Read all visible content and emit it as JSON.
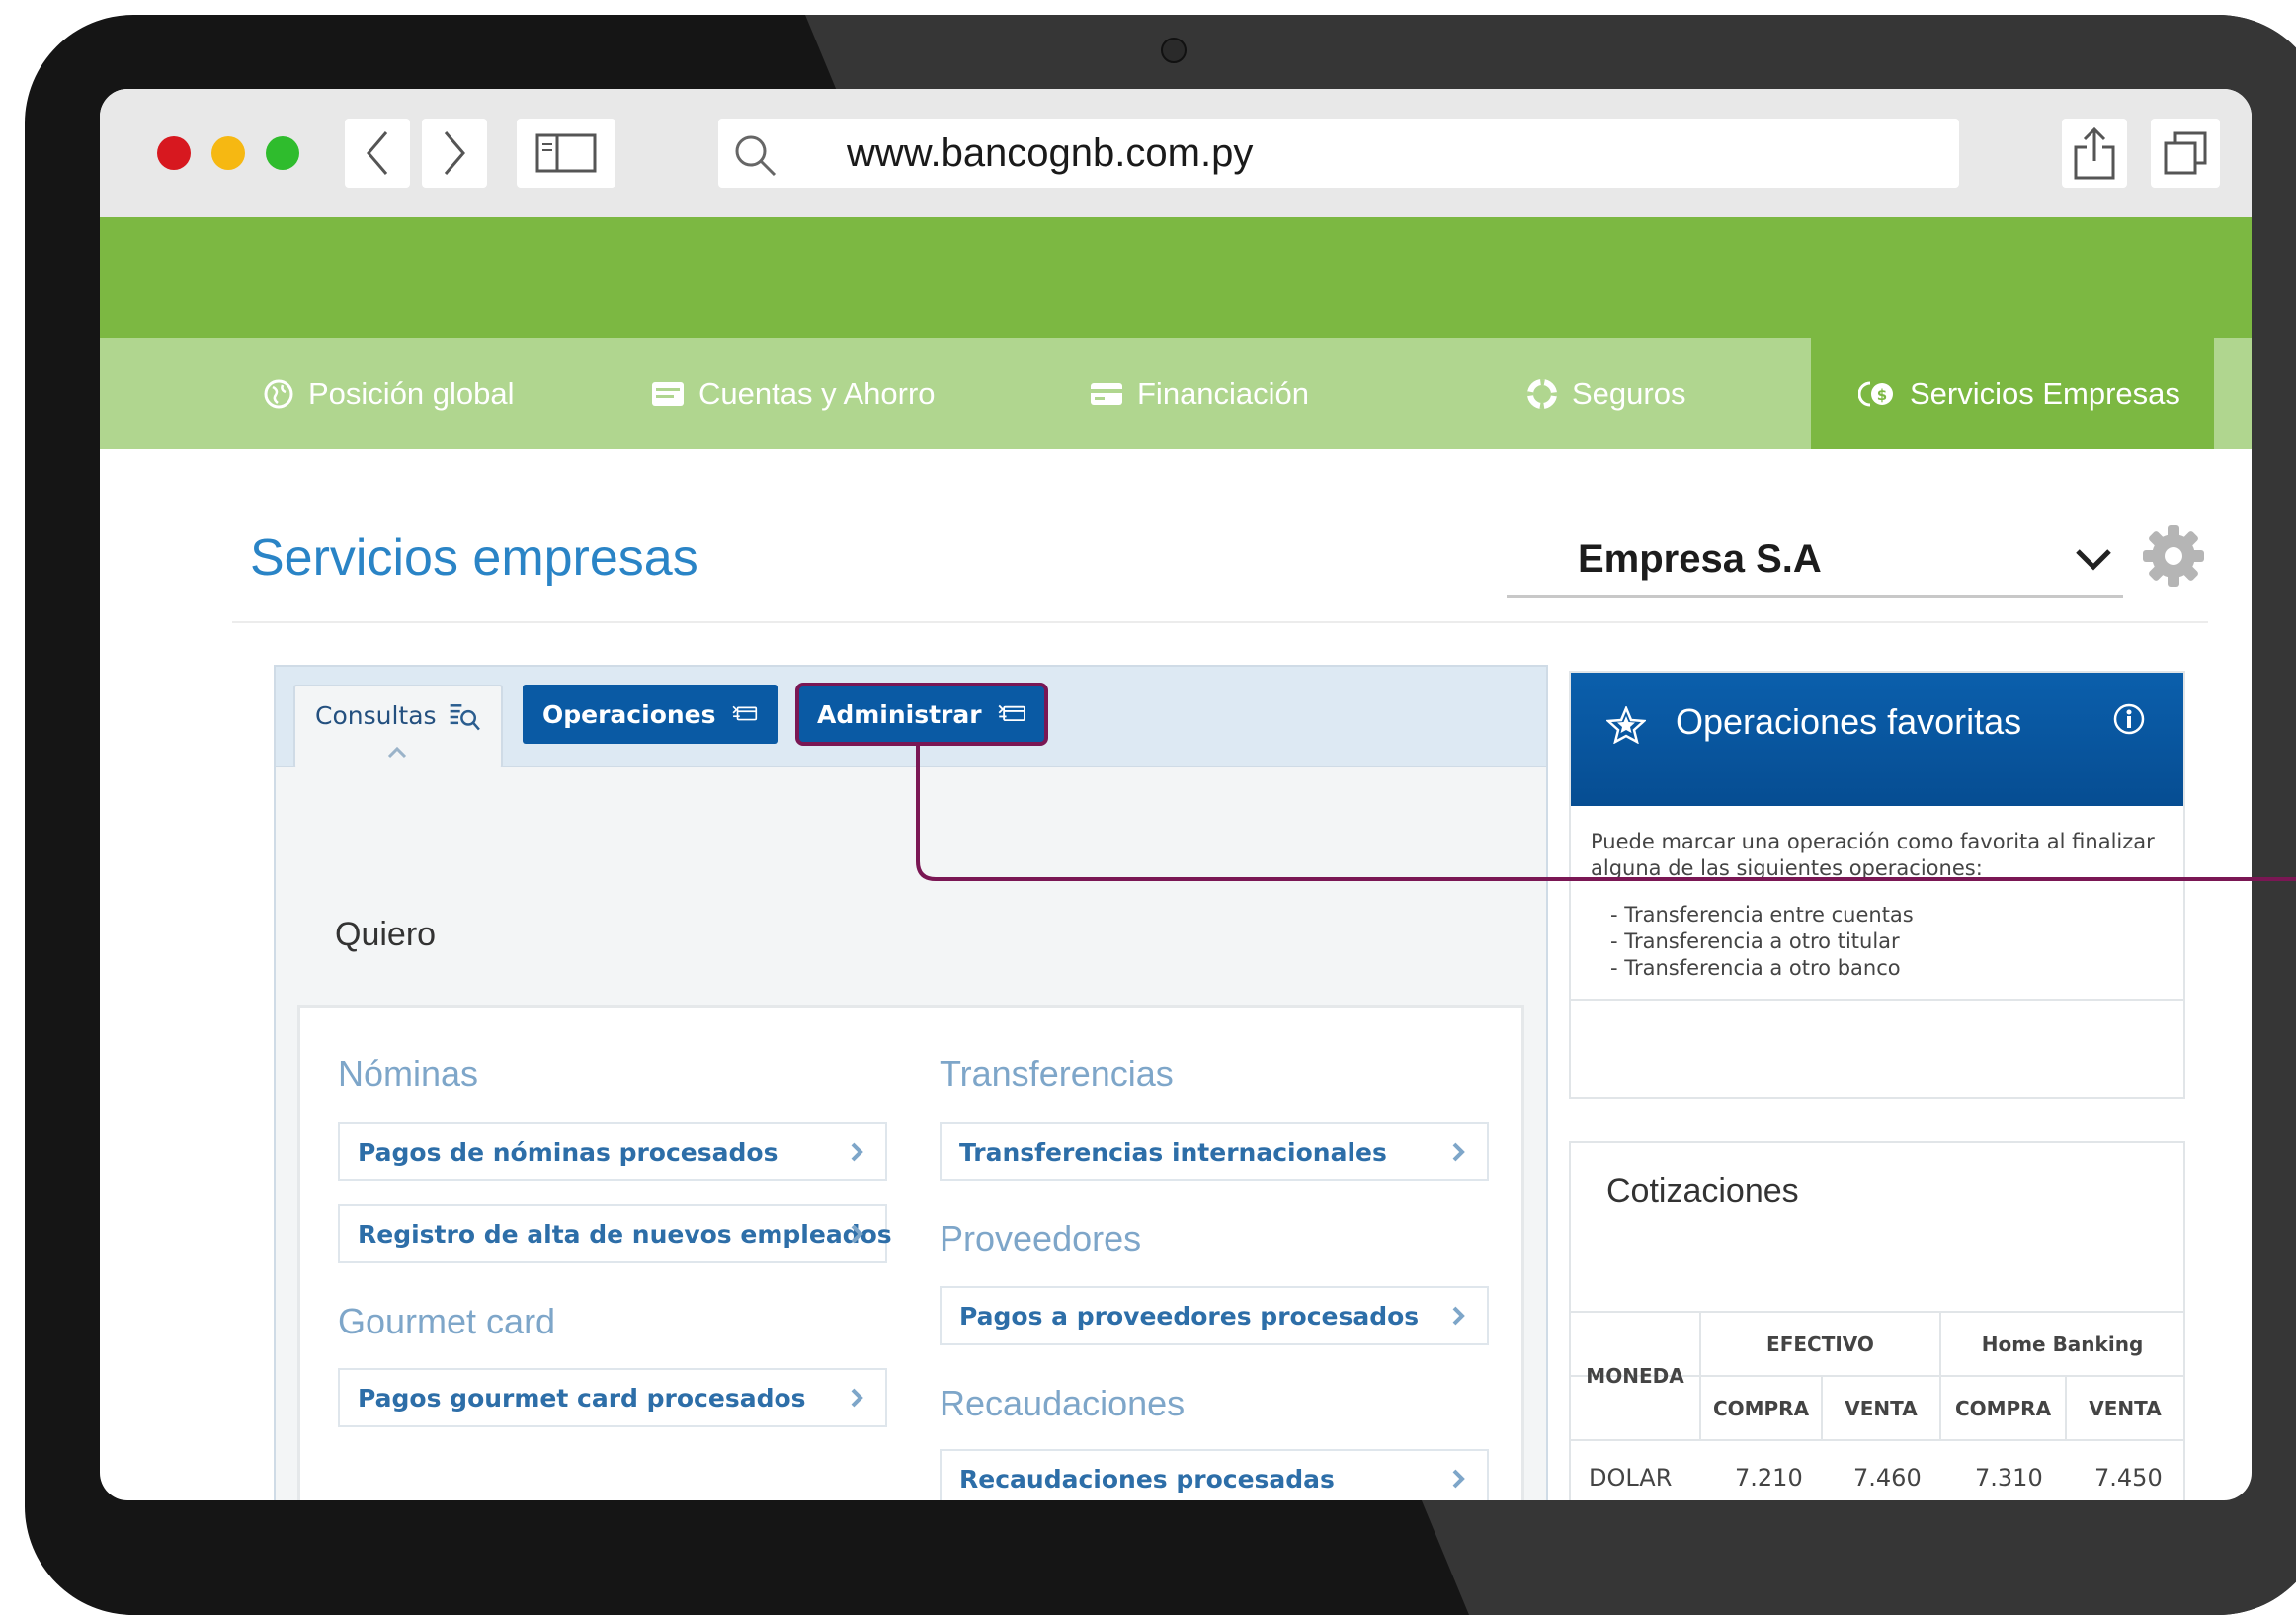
{
  "browser": {
    "url": "www.bancognb.com.py"
  },
  "nav": {
    "items": [
      {
        "label": "Posición global"
      },
      {
        "label": "Cuentas y Ahorro"
      },
      {
        "label": "Financiación"
      },
      {
        "label": "Seguros"
      },
      {
        "label": "Servicios Empresas"
      }
    ],
    "active": "Servicios Empresas"
  },
  "page": {
    "title": "Servicios empresas",
    "company": "Empresa S.A"
  },
  "tabs": [
    {
      "label": "Consultas"
    },
    {
      "label": "Operaciones"
    },
    {
      "label": "Administrar"
    }
  ],
  "main": {
    "quiero": "Quiero",
    "sections": {
      "nominas": {
        "title": "Nóminas",
        "links": [
          "Pagos de nóminas procesados",
          "Registro de alta de nuevos empleados"
        ]
      },
      "gourmet": {
        "title": "Gourmet card",
        "links": [
          "Pagos gourmet card procesados"
        ]
      },
      "transferencias": {
        "title": "Transferencias",
        "links": [
          "Transferencias internacionales"
        ]
      },
      "proveedores": {
        "title": "Proveedores",
        "links": [
          "Pagos a proveedores procesados"
        ]
      },
      "recaudaciones": {
        "title": "Recaudaciones",
        "links": [
          "Recaudaciones procesadas"
        ]
      }
    }
  },
  "favoritas": {
    "title": "Operaciones favoritas",
    "text": "Puede marcar una operación como favorita al finalizar alguna de las siguientes operaciones:",
    "items": [
      "- Transferencia entre cuentas",
      "- Transferencia a otro titular",
      "- Transferencia a otro banco"
    ]
  },
  "cotizaciones": {
    "title": "Cotizaciones",
    "headers": {
      "moneda": "MONEDA",
      "efectivo": "EFECTIVO",
      "home_banking": "Home Banking",
      "compra": "COMPRA",
      "venta": "VENTA"
    },
    "rows": [
      {
        "moneda": "DOLAR",
        "efectivo_compra": "7.210",
        "efectivo_venta": "7.460",
        "hb_compra": "7.310",
        "hb_venta": "7.450"
      }
    ]
  },
  "colors": {
    "green_header": "#7cb842",
    "green_nav": "#b0d68f",
    "blue_primary": "#0a5aa4",
    "title_blue": "#2a84c6",
    "highlight": "#7a1754"
  }
}
